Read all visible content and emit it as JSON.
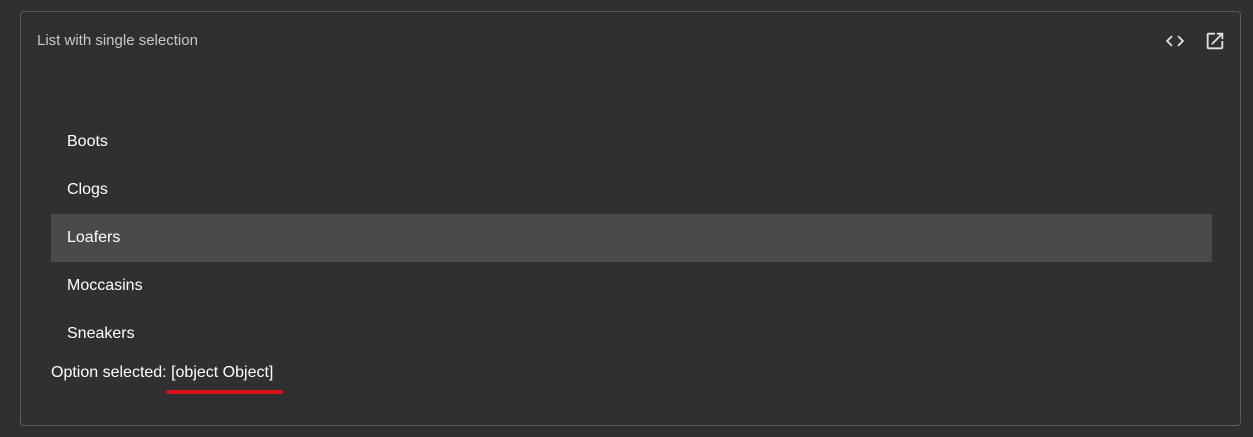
{
  "card": {
    "title": "List with single selection",
    "actions": [
      {
        "label": "View code",
        "icon": "code-icon"
      },
      {
        "label": "Open in new window",
        "icon": "open-in-new-icon"
      }
    ]
  },
  "list": {
    "options": [
      "Boots",
      "Clogs",
      "Loafers",
      "Moccasins",
      "Sneakers"
    ],
    "selected": "Loafers"
  },
  "status": {
    "label": "Option selected:",
    "value": "[object Object]"
  },
  "colors": {
    "background": "#303030",
    "border": "#5a5a5a",
    "selected_background": "#4a4a4a",
    "underline": "#d7141a"
  }
}
